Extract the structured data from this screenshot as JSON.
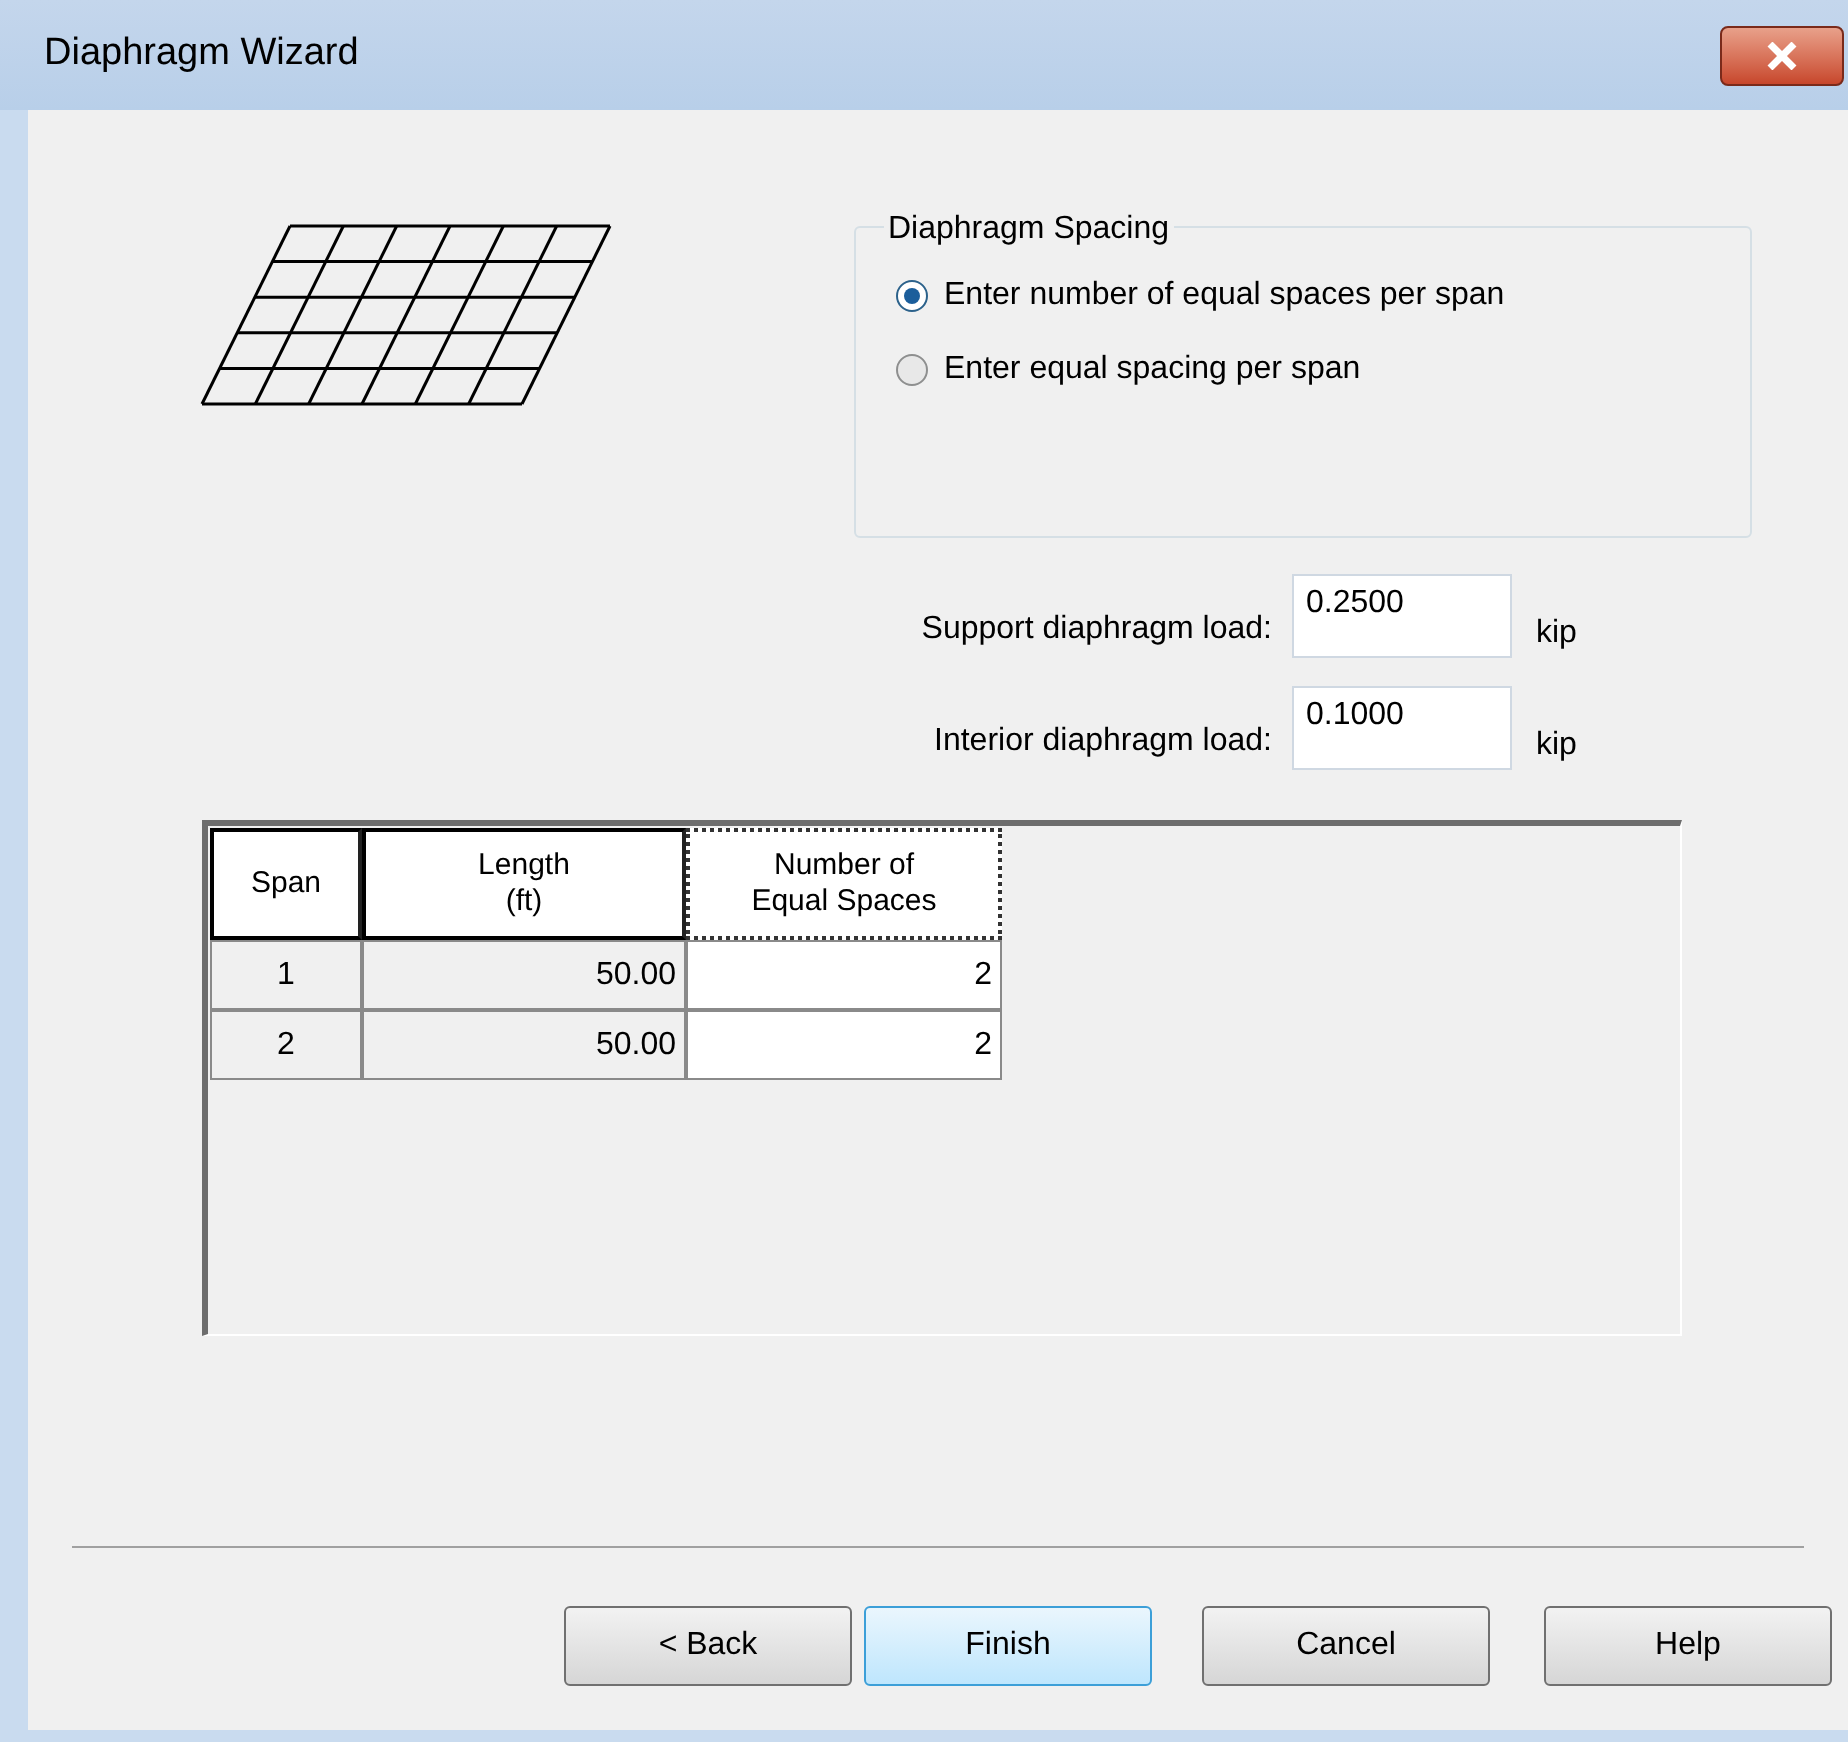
{
  "window": {
    "title": "Diaphragm Wizard"
  },
  "spacing_group": {
    "title": "Diaphragm Spacing",
    "options": [
      {
        "label": "Enter number of equal spaces per span",
        "selected": true
      },
      {
        "label": "Enter equal spacing per span",
        "selected": false
      }
    ]
  },
  "loads": [
    {
      "label": "Support diaphragm load:",
      "value": "0.2500",
      "unit": "kip"
    },
    {
      "label": "Interior diaphragm load:",
      "value": "0.1000",
      "unit": "kip"
    }
  ],
  "table": {
    "columns": [
      {
        "label": "Span",
        "focused": false
      },
      {
        "label": "Length",
        "line2": "(ft)",
        "focused": false
      },
      {
        "label": "Number of",
        "line2": "Equal Spaces",
        "focused": true
      }
    ],
    "rows": [
      [
        "1",
        "50.00",
        "2"
      ],
      [
        "2",
        "50.00",
        "2"
      ]
    ]
  },
  "buttons": [
    {
      "label": "< Back",
      "default": false
    },
    {
      "label": "Finish",
      "default": true
    },
    {
      "label": "Cancel",
      "default": false
    },
    {
      "label": "Help",
      "default": false
    }
  ]
}
